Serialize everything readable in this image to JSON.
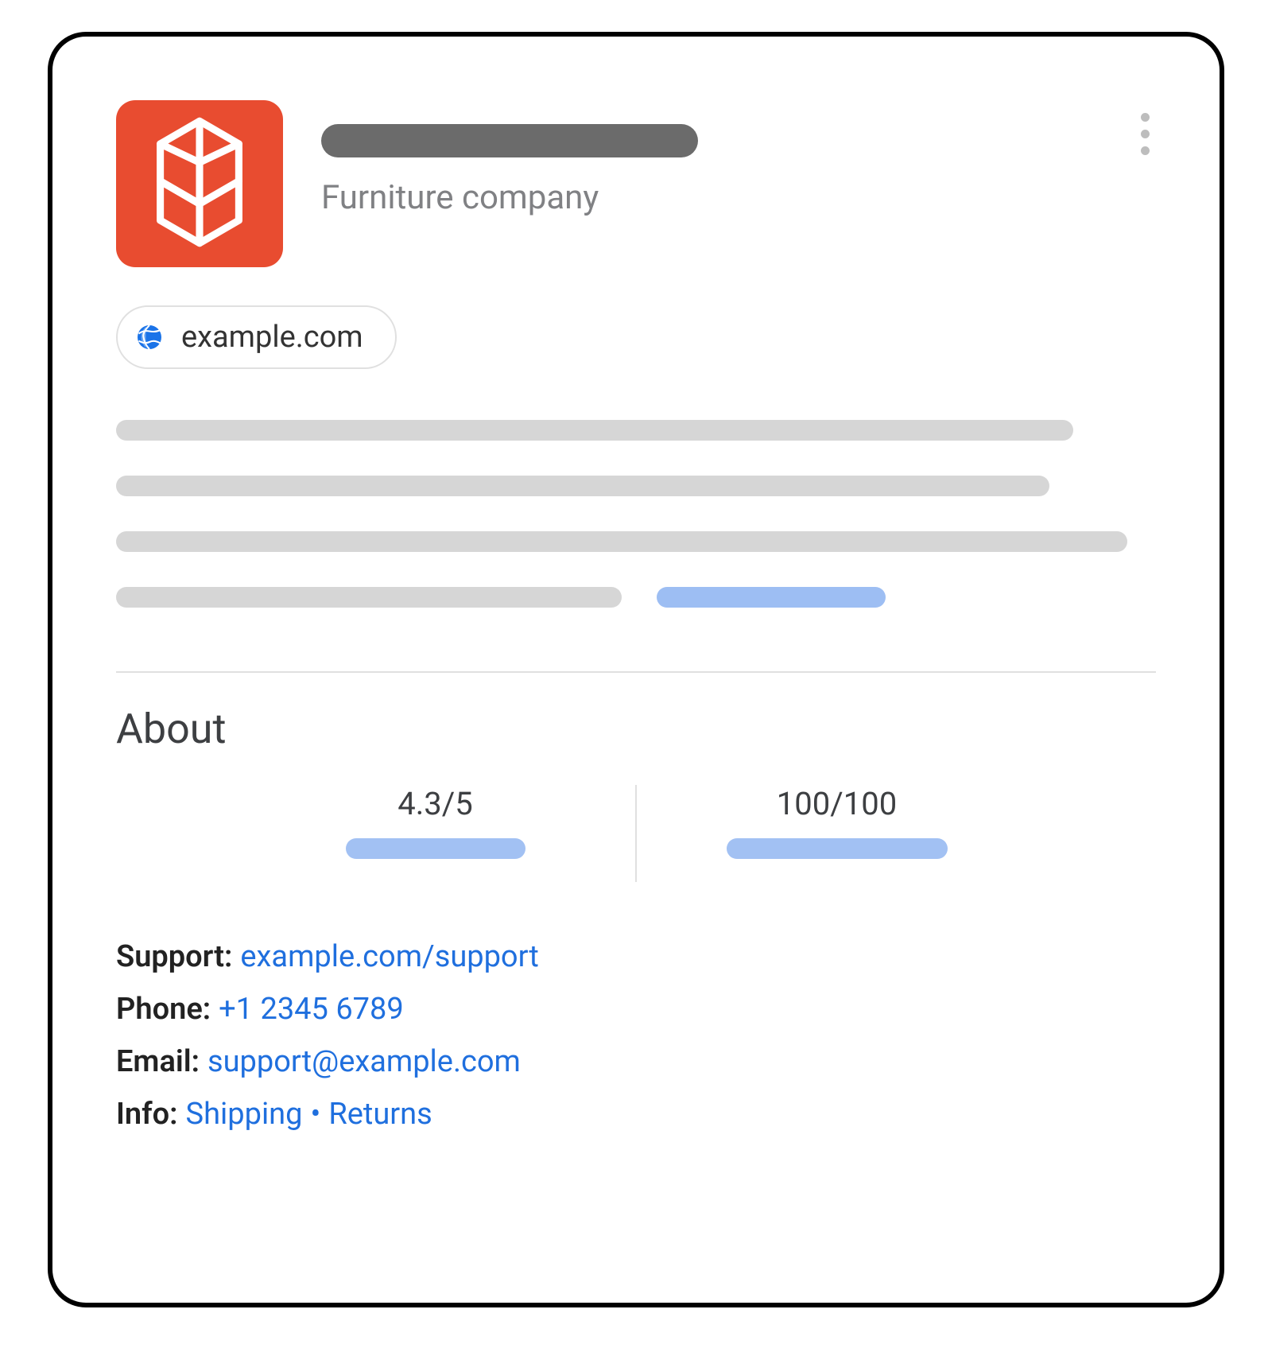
{
  "header": {
    "subtitle": "Furniture company",
    "logo_color": "#e84c30"
  },
  "site_chip": {
    "text": "example.com"
  },
  "about": {
    "heading": "About",
    "scores": [
      {
        "value": "4.3/5"
      },
      {
        "value": "100/100"
      }
    ],
    "support": {
      "label": "Support:",
      "link": "example.com/support"
    },
    "phone": {
      "label": "Phone:",
      "link": "+1 2345 6789"
    },
    "email": {
      "label": "Email:",
      "link": "support@example.com"
    },
    "info": {
      "label": "Info:",
      "link1": "Shipping",
      "bullet": "•",
      "link2": "Returns"
    }
  }
}
